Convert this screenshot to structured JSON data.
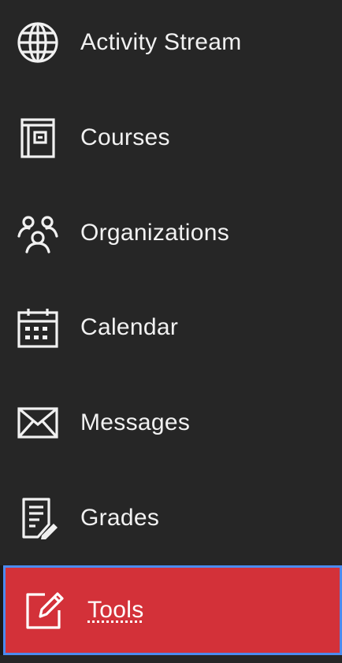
{
  "nav": {
    "items": [
      {
        "label": "Activity Stream",
        "icon": "globe-icon"
      },
      {
        "label": "Courses",
        "icon": "book-icon"
      },
      {
        "label": "Organizations",
        "icon": "people-icon"
      },
      {
        "label": "Calendar",
        "icon": "calendar-icon"
      },
      {
        "label": "Messages",
        "icon": "envelope-icon"
      },
      {
        "label": "Grades",
        "icon": "document-icon"
      },
      {
        "label": "Tools",
        "icon": "edit-icon",
        "selected": true
      }
    ]
  },
  "colors": {
    "background": "#262626",
    "text": "#f1f1f1",
    "active_background": "#d33139",
    "focus_border": "#4c8bf0"
  }
}
